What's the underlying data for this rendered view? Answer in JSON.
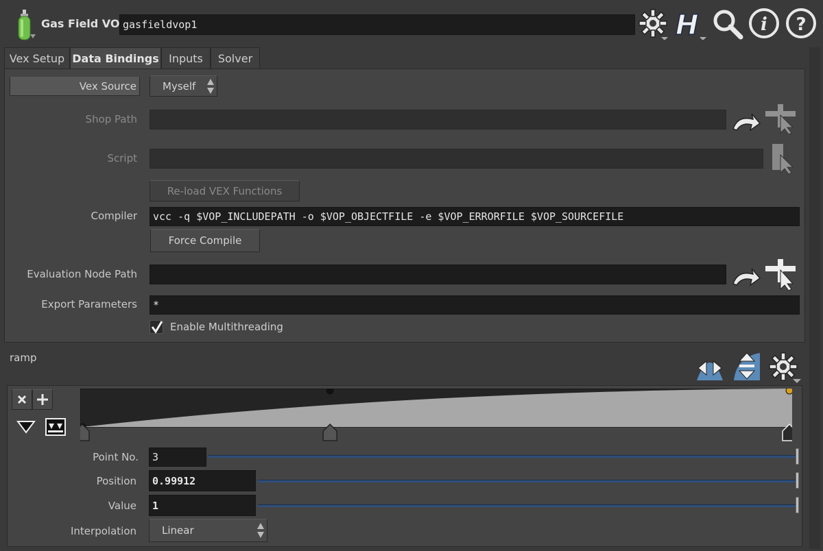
{
  "header": {
    "node_type": "Gas Field VOP",
    "node_name": "gasfieldvop1",
    "icons": [
      "gas-cylinder-icon",
      "gear-icon",
      "houdini-help-icon",
      "search-icon",
      "info-icon",
      "help-icon"
    ]
  },
  "tabs": [
    {
      "label": "Vex Setup",
      "active": false
    },
    {
      "label": "Data Bindings",
      "active": true
    },
    {
      "label": "Inputs",
      "active": false
    },
    {
      "label": "Solver",
      "active": false
    }
  ],
  "vex_source": {
    "label": "Vex Source",
    "value": "Myself"
  },
  "shop_path": {
    "label": "Shop Path",
    "value": ""
  },
  "script": {
    "label": "Script",
    "value": ""
  },
  "reload_button": "Re-load VEX Functions",
  "compiler": {
    "label": "Compiler",
    "value": "vcc -q $VOP_INCLUDEPATH -o $VOP_OBJECTFILE -e $VOP_ERRORFILE $VOP_SOURCEFILE"
  },
  "force_compile_button": "Force Compile",
  "eval_path": {
    "label": "Evaluation Node Path",
    "value": ""
  },
  "export_params": {
    "label": "Export Parameters",
    "value": "*"
  },
  "multithreading": {
    "label": "Enable Multithreading",
    "checked": true
  },
  "ramp": {
    "label": "ramp",
    "point_no": {
      "label": "Point No.",
      "value": "3"
    },
    "position": {
      "label": "Position",
      "value": "0.99912"
    },
    "value": {
      "label": "Value",
      "value": "1"
    },
    "interpolation": {
      "label": "Interpolation",
      "value": "Linear"
    },
    "points": [
      {
        "position": 0.0,
        "value": 0.0
      },
      {
        "position": 0.35,
        "value": 1.0
      },
      {
        "position": 0.99912,
        "value": 1.0
      }
    ]
  },
  "colors": {
    "bg": "#3a3a3a",
    "field": "#1c1c1c",
    "slider": "#2f4f7a",
    "selected_key": "#d8a020"
  }
}
